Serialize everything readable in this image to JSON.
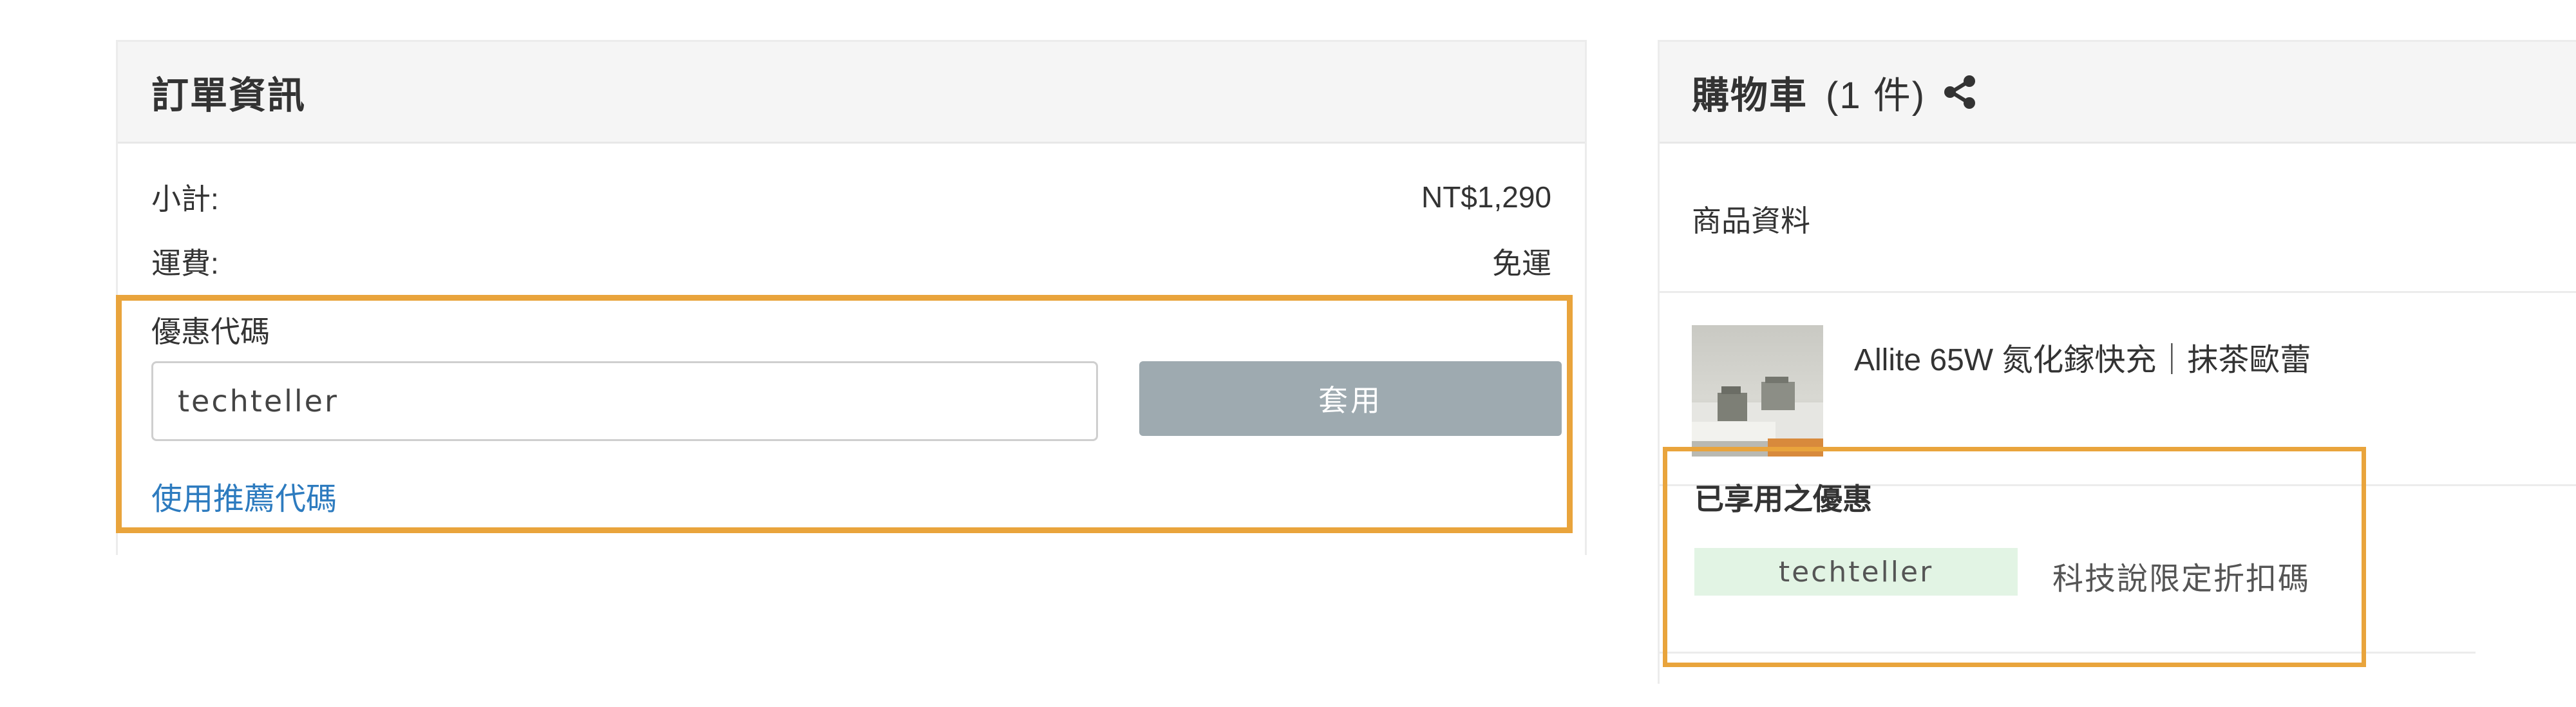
{
  "order": {
    "title": "訂單資訊",
    "subtotal_label": "小計:",
    "subtotal_value": "NT$1,290",
    "shipping_label": "運費:",
    "shipping_value": "免運",
    "coupon": {
      "label": "優惠代碼",
      "input_value": "techteller",
      "apply_label": "套用",
      "referral_link": "使用推薦代碼"
    }
  },
  "cart": {
    "title": "購物車",
    "count": "(1 件)",
    "share_icon": "share-icon",
    "subheader": "商品資料",
    "product": {
      "name": "Allite 65W 氮化鎵快充｜抹茶歐蕾"
    },
    "applied_discount": {
      "title": "已享用之優惠",
      "code": "techteller",
      "description": "科技說限定折扣碼"
    }
  },
  "colors": {
    "highlight": "#e9a43c",
    "link": "#2d7bbf",
    "apply_button": "#9eaab0",
    "code_badge": "#e2f4e4"
  }
}
